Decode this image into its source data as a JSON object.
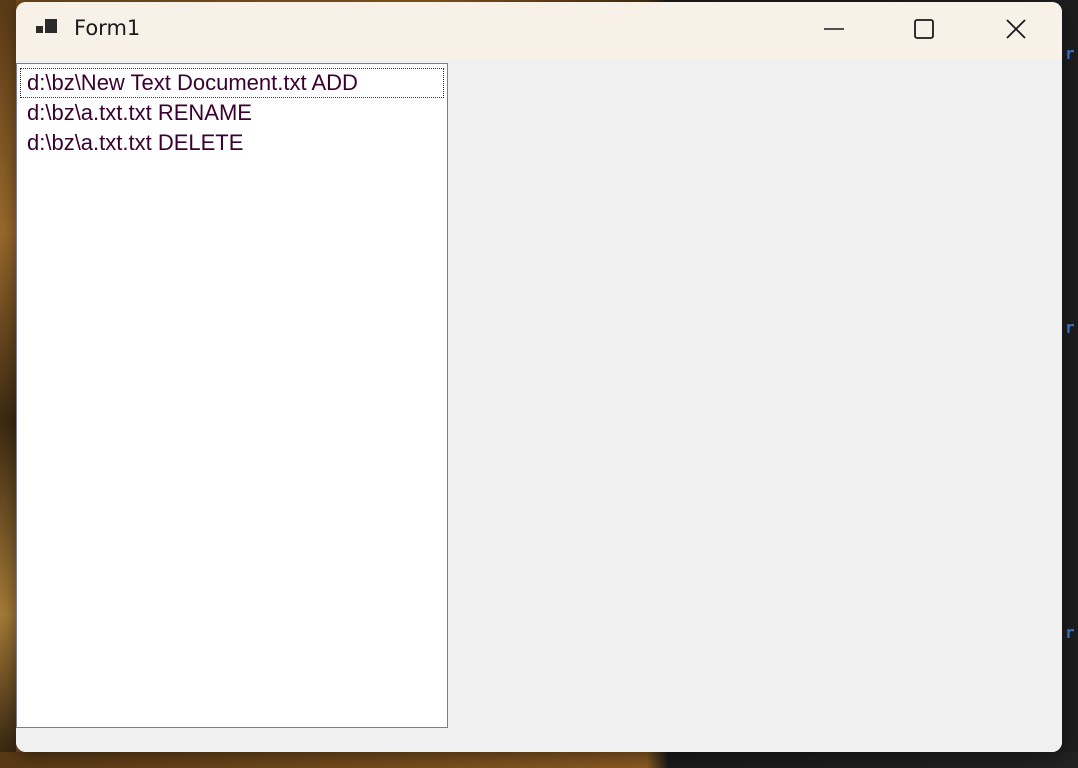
{
  "window": {
    "title": "Form1"
  },
  "caption_buttons": {
    "minimize": "minimize-icon",
    "maximize": "maximize-icon",
    "close": "close-icon"
  },
  "listbox": {
    "items": [
      {
        "label": "d:\\bz\\New Text Document.txt ADD",
        "focused": true
      },
      {
        "label": "d:\\bz\\a.txt.txt RENAME",
        "focused": false
      },
      {
        "label": "d:\\bz\\a.txt.txt DELETE",
        "focused": false
      }
    ]
  },
  "background": {
    "right_edge_glyph": "r"
  },
  "colors": {
    "titlebar": "#f7f1e8",
    "client": "#f0f0f0",
    "list_text": "#3a0030",
    "code_blue": "#3a7bd5"
  }
}
